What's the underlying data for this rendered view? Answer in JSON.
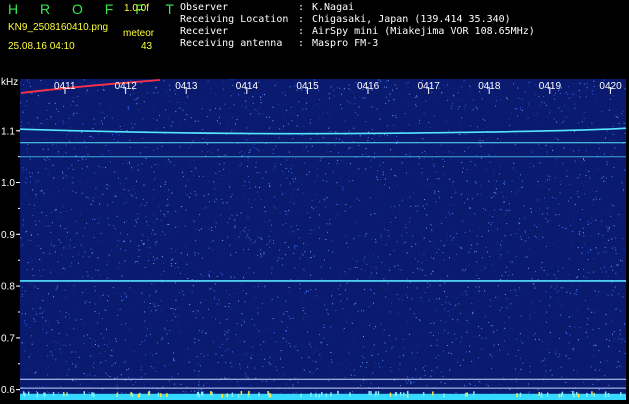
{
  "app": {
    "title": "H R O F F T",
    "version": "1.0.0f"
  },
  "image": {
    "filename": "KN9_2508160410.png",
    "timestamp": "25.08.16 04:10",
    "meteor_label": "meteor",
    "meteor_count": "43"
  },
  "info": [
    {
      "key": "Observer",
      "value": "K.Nagai"
    },
    {
      "key": "Receiving Location",
      "value": "Chigasaki, Japan (139.414 35.340)"
    },
    {
      "key": "Receiver",
      "value": "AirSpy mini (Miakejima VOR 108.65MHz)"
    },
    {
      "key": "Receiving antenna",
      "value": "Maspro FM-3"
    }
  ],
  "colon": ":",
  "chart_data": {
    "type": "heatmap",
    "ylabel": "kHz",
    "ylim": [
      0.58,
      1.2
    ],
    "y_ticks": [
      0.6,
      0.7,
      0.8,
      0.9,
      1.0,
      1.1
    ],
    "x_ticks": [
      "0411",
      "0412",
      "0413",
      "0414",
      "0415",
      "0416",
      "0417",
      "0418",
      "0419",
      "0420"
    ],
    "xlim": [
      "04:10",
      "04:20"
    ],
    "signal_lines_khz": [
      1.103,
      1.077,
      1.05,
      0.81,
      0.62,
      0.603
    ],
    "colors": {
      "background": "#0a1a6e",
      "noise": "#3b74ff",
      "signal": "#55e6ff",
      "meteor": "#ff3344",
      "bottom_band": "#35d9ff"
    }
  }
}
